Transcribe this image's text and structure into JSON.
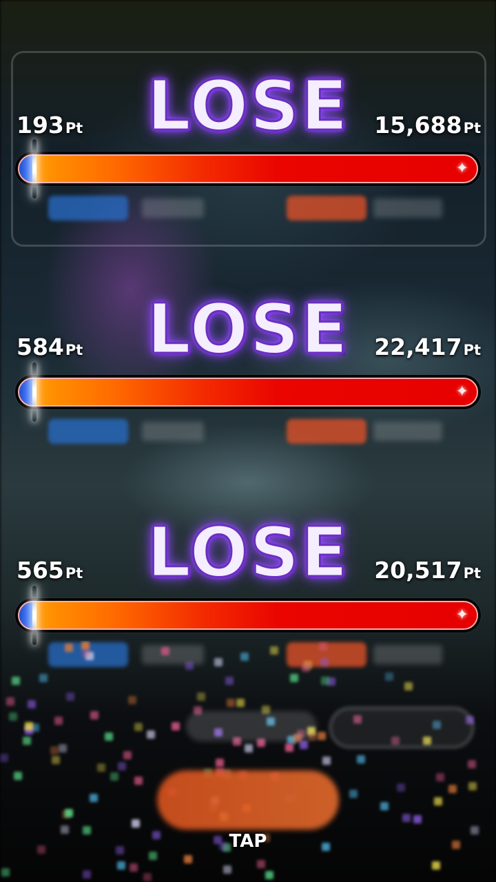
{
  "rounds": [
    {
      "result": "LOSE",
      "left_score": "193",
      "right_score": "15,688",
      "unit": "Pt",
      "left_share": 0.012
    },
    {
      "result": "LOSE",
      "left_score": "584",
      "right_score": "22,417",
      "unit": "Pt",
      "left_share": 0.025
    },
    {
      "result": "LOSE",
      "left_score": "565",
      "right_score": "20,517",
      "unit": "Pt",
      "left_share": 0.027
    }
  ],
  "prompt": "TAP",
  "colors": {
    "lose_fill": "#f4eeff",
    "lose_glow": "#8a44ff",
    "player_bar": "#1d4fd8",
    "opponent_bar": "#e60000"
  }
}
